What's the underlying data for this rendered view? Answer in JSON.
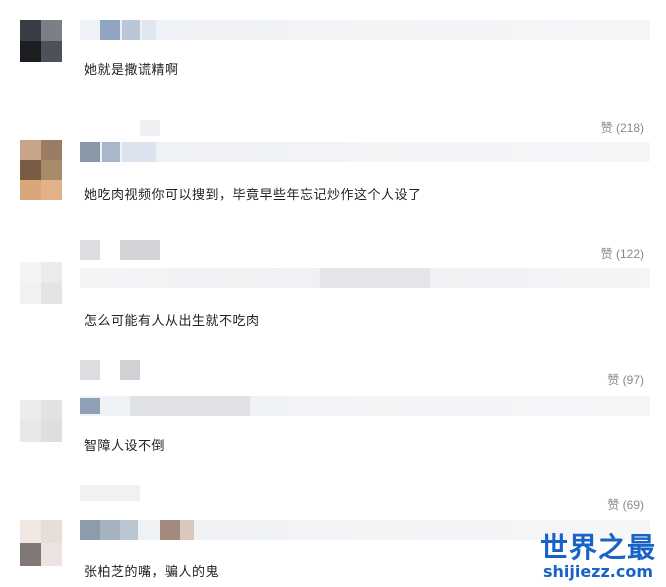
{
  "comments": [
    {
      "text": "她就是撒谎精啊",
      "likes": ""
    },
    {
      "text": "她吃肉视频你可以搜到，毕竟早些年忘记炒作这个人设了",
      "likes": "赞 (218)"
    },
    {
      "text": "怎么可能有人从出生就不吃肉",
      "likes": "赞 (122)"
    },
    {
      "text": "智障人设不倒",
      "likes": "赞 (97)"
    },
    {
      "text": "张柏芝的嘴，骗人的鬼",
      "likes": "赞 (69)"
    }
  ],
  "watermark": {
    "title": "世界之最",
    "url": "shijiezz.com",
    "color": "#1a63c6"
  }
}
